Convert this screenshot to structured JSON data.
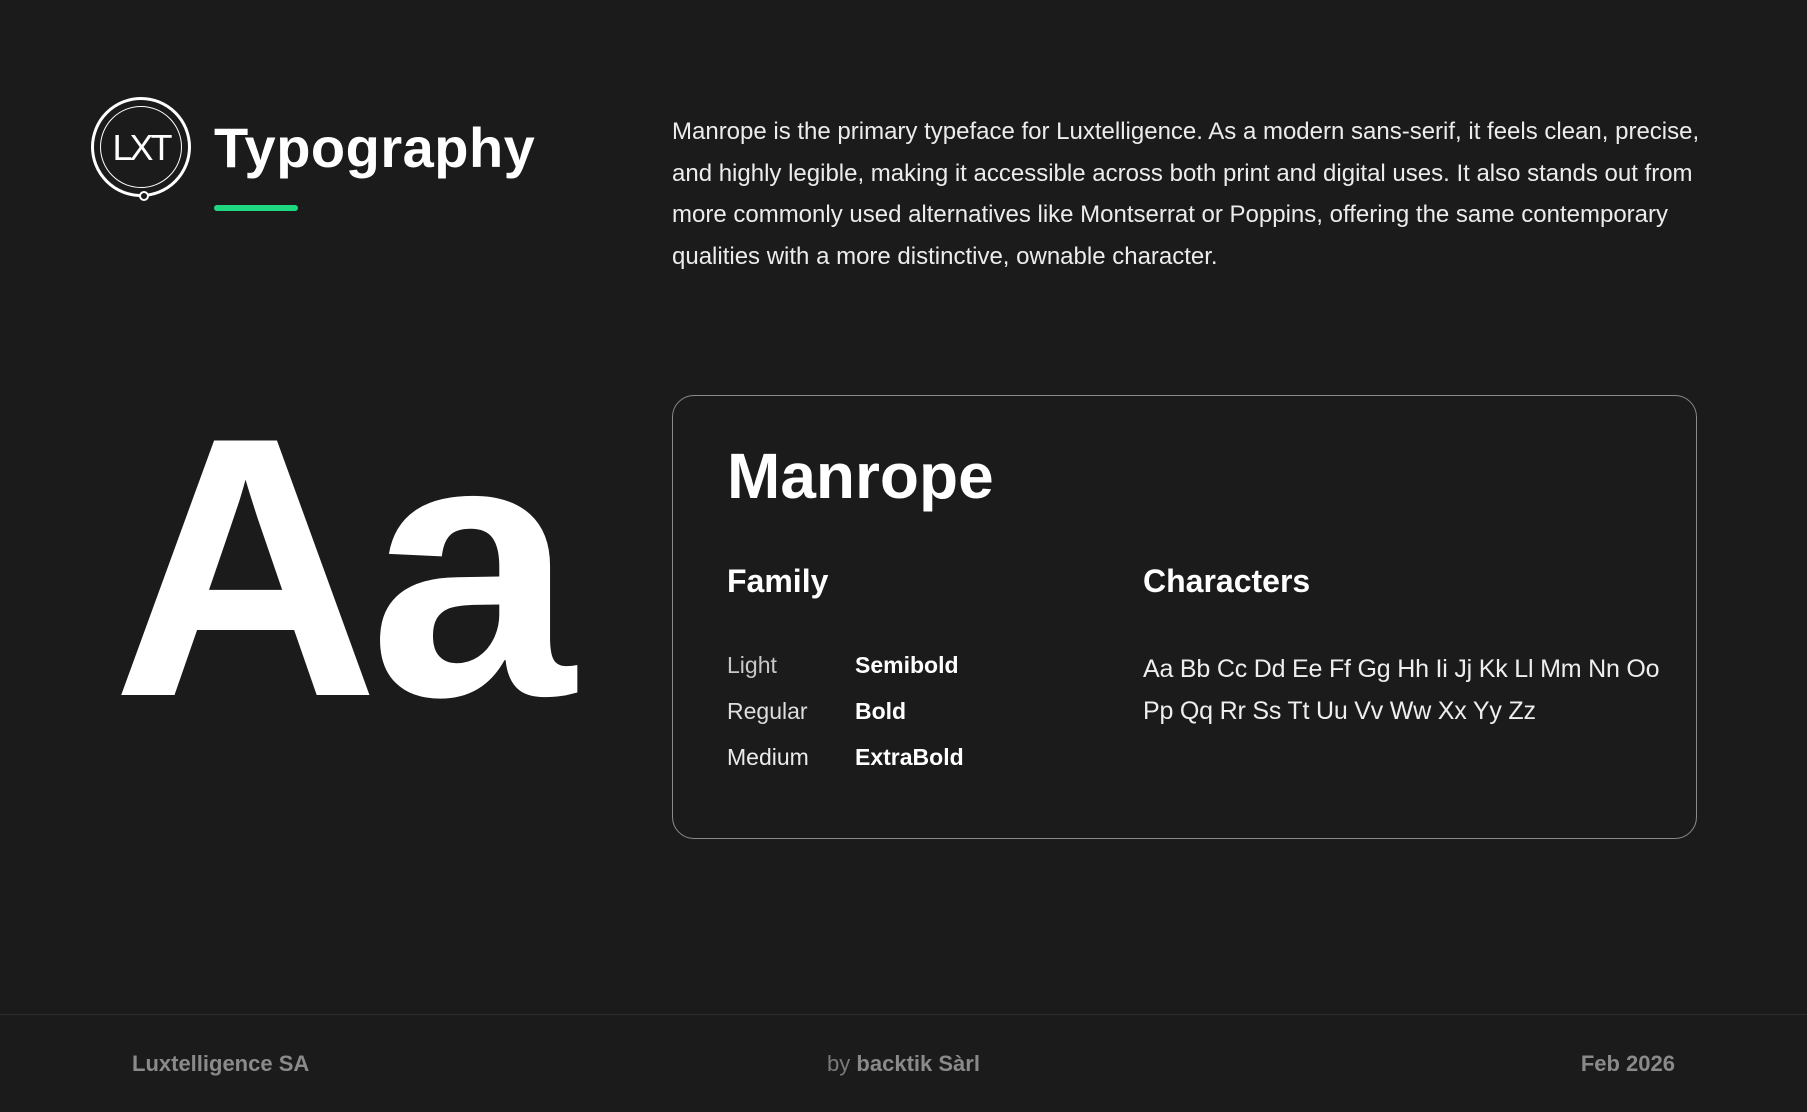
{
  "header": {
    "logo_text": "LXT",
    "title": "Typography",
    "accent_color": "#1fd882"
  },
  "intro": {
    "text": "Manrope is the primary typeface for Luxtelligence. As a modern sans-serif, it feels clean, precise, and highly legible, making it accessible across both print and digital uses. It also stands out from more commonly used alternatives like Montserrat or Poppins, offering the same contemporary qualities with a more distinctive, ownable character."
  },
  "specimen": {
    "glyphs": "Aa"
  },
  "font_card": {
    "name": "Manrope",
    "family_heading": "Family",
    "characters_heading": "Characters",
    "weights": {
      "light": "Light",
      "regular": "Regular",
      "medium": "Medium",
      "semibold": "Semibold",
      "bold": "Bold",
      "extrabold": "ExtraBold"
    },
    "characters": [
      "Aa Bb Cc Dd Ee Ff Gg Hh Ii Jj Kk Ll Mm Nn Oo",
      "Pp Qq Rr Ss Tt Uu Vv Ww Xx Yy Zz"
    ]
  },
  "footer": {
    "left": "Luxtelligence SA",
    "center_prefix": "by",
    "center_name": "backtik Sàrl",
    "right": "Feb 2026"
  },
  "colors": {
    "background": "#1b1b1b",
    "text": "#ffffff",
    "accent": "#1fd882",
    "muted": "#8a8a8a"
  }
}
